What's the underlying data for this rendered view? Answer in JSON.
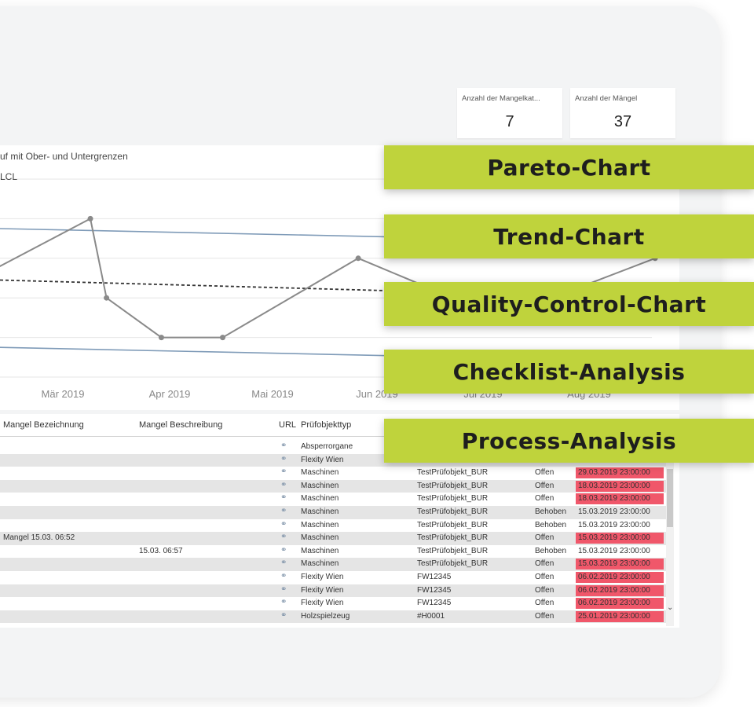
{
  "kpis": [
    {
      "label": "Anzahl der Mangelkat...",
      "value": "7"
    },
    {
      "label": "Anzahl der Mängel",
      "value": "37"
    }
  ],
  "chart_title": "uf mit Ober- und Untergrenzen",
  "chart_legend_fragment": "LCL",
  "chart_data": {
    "type": "line",
    "x_tick_labels": [
      "Mär 2019",
      "Apr 2019",
      "Mai 2019",
      "Jun 2019",
      "Jul 2019",
      "Aug 2019"
    ],
    "series": [
      {
        "values": [
          {
            "x": "2019-02-03",
            "y": 5.0
          },
          {
            "x": "2019-03-10",
            "y": 8.0
          },
          {
            "x": "2019-03-15",
            "y": 4.0
          },
          {
            "x": "2019-04-01",
            "y": 2.0
          },
          {
            "x": "2019-04-20",
            "y": 2.0
          },
          {
            "x": "2019-06-01",
            "y": 6.0
          },
          {
            "x": "2019-07-15",
            "y": 3.0
          },
          {
            "x": "2019-09-01",
            "y": 6.0
          }
        ]
      }
    ],
    "reference_lines": [
      {
        "name": "UCL",
        "start": 7.5,
        "end": 6.8,
        "style": "solid",
        "color": "#7f9bb8"
      },
      {
        "name": "Mittelwert",
        "start": 4.9,
        "end": 4.0,
        "style": "dashed",
        "color": "#333333"
      },
      {
        "name": "LCL",
        "start": 1.5,
        "end": 0.8,
        "style": "solid",
        "color": "#7f9bb8"
      }
    ],
    "ylim": [
      0,
      10
    ],
    "grid": true
  },
  "table": {
    "headers": [
      "Mangel Bezeichnung",
      "Mangel Beschreibung",
      "URL",
      "Prüfobjekttyp"
    ],
    "rows": [
      {
        "bez": "",
        "beschr": "",
        "typ": "Absperrorgane",
        "obj": "",
        "status": "",
        "datum": "",
        "red": false
      },
      {
        "bez": "",
        "beschr": "",
        "typ": "Flexity Wien",
        "obj": "",
        "status": "",
        "datum": "",
        "red": false
      },
      {
        "bez": "",
        "beschr": "",
        "typ": "Maschinen",
        "obj": "TestPrüfobjekt_BUR",
        "status": "Offen",
        "datum": "29.03.2019 23:00:00",
        "red": true
      },
      {
        "bez": "",
        "beschr": "",
        "typ": "Maschinen",
        "obj": "TestPrüfobjekt_BUR",
        "status": "Offen",
        "datum": "18.03.2019 23:00:00",
        "red": true
      },
      {
        "bez": "",
        "beschr": "",
        "typ": "Maschinen",
        "obj": "TestPrüfobjekt_BUR",
        "status": "Offen",
        "datum": "18.03.2019 23:00:00",
        "red": true
      },
      {
        "bez": "",
        "beschr": "",
        "typ": "Maschinen",
        "obj": "TestPrüfobjekt_BUR",
        "status": "Behoben",
        "datum": "15.03.2019 23:00:00",
        "red": false
      },
      {
        "bez": "",
        "beschr": "",
        "typ": "Maschinen",
        "obj": "TestPrüfobjekt_BUR",
        "status": "Behoben",
        "datum": "15.03.2019 23:00:00",
        "red": false
      },
      {
        "bez": "Mangel 15.03. 06:52",
        "beschr": "",
        "typ": "Maschinen",
        "obj": "TestPrüfobjekt_BUR",
        "status": "Offen",
        "datum": "15.03.2019 23:00:00",
        "red": true
      },
      {
        "bez": "",
        "beschr": "15.03. 06:57",
        "typ": "Maschinen",
        "obj": "TestPrüfobjekt_BUR",
        "status": "Behoben",
        "datum": "15.03.2019 23:00:00",
        "red": false
      },
      {
        "bez": "",
        "beschr": "",
        "typ": "Maschinen",
        "obj": "TestPrüfobjekt_BUR",
        "status": "Offen",
        "datum": "15.03.2019 23:00:00",
        "red": true
      },
      {
        "bez": "",
        "beschr": "",
        "typ": "Flexity Wien",
        "obj": "FW12345",
        "status": "Offen",
        "datum": "06.02.2019 23:00:00",
        "red": true
      },
      {
        "bez": "",
        "beschr": "",
        "typ": "Flexity Wien",
        "obj": "FW12345",
        "status": "Offen",
        "datum": "06.02.2019 23:00:00",
        "red": true
      },
      {
        "bez": "",
        "beschr": "",
        "typ": "Flexity Wien",
        "obj": "FW12345",
        "status": "Offen",
        "datum": "06.02.2019 23:00:00",
        "red": true
      },
      {
        "bez": "",
        "beschr": "",
        "typ": "Holzspielzeug",
        "obj": "#H0001",
        "status": "Offen",
        "datum": "25.01.2019 23:00:00",
        "red": true
      }
    ]
  },
  "feature_tags": [
    "Pareto-Chart",
    "Trend-Chart",
    "Quality-Control-Chart",
    "Checklist-Analysis",
    "Process-Analysis"
  ],
  "icons": {
    "link": "link-icon",
    "scroll": "chevron-down-icon"
  },
  "colors": {
    "tag_bg": "#bfd33c",
    "alert_red": "#f0576a",
    "limit_line": "#7f9bb8"
  }
}
